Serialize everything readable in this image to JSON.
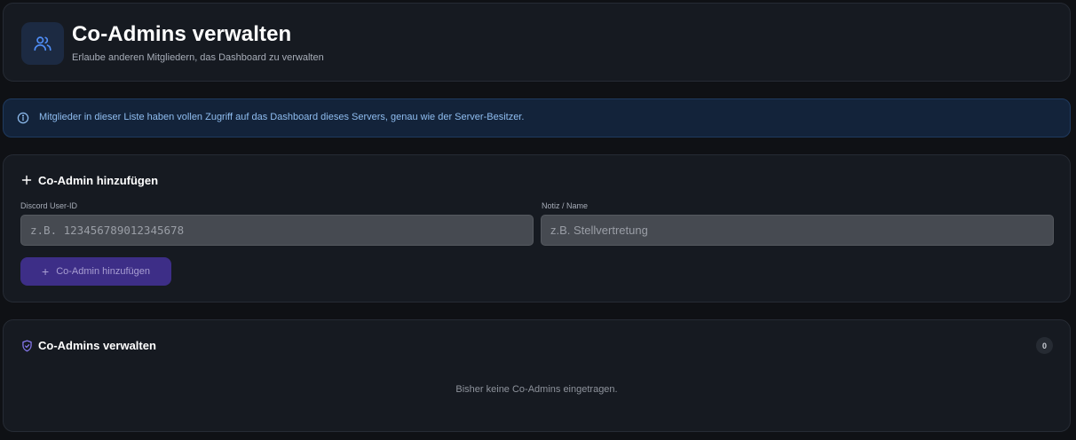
{
  "header": {
    "title": "Co-Admins verwalten",
    "subtitle": "Erlaube anderen Mitgliedern, das Dashboard zu verwalten",
    "icon": "users-icon"
  },
  "info": {
    "icon": "info-icon",
    "text": "Mitglieder in dieser Liste haben vollen Zugriff auf das Dashboard dieses Servers, genau wie der Server-Besitzer."
  },
  "add_form": {
    "title": "Co-Admin hinzufügen",
    "title_icon": "plus-icon",
    "user_id_label": "Discord User-ID",
    "user_id_placeholder": "z.B. 123456789012345678",
    "user_id_value": "",
    "note_label": "Notiz / Name",
    "note_placeholder": "z.B. Stellvertretung",
    "note_value": "",
    "submit_icon": "+",
    "submit_label": "Co-Admin hinzufügen"
  },
  "list": {
    "title": "Co-Admins verwalten",
    "title_icon": "shield-icon",
    "count": "0",
    "empty_text": "Bisher keine Co-Admins eingetragen."
  },
  "colors": {
    "background": "#0f1115",
    "card": "#161a21",
    "accent_icon": "#4f8ef7",
    "button": "#3d2e87",
    "info_text": "#8fbdf0",
    "shield": "#8b7cf6"
  }
}
